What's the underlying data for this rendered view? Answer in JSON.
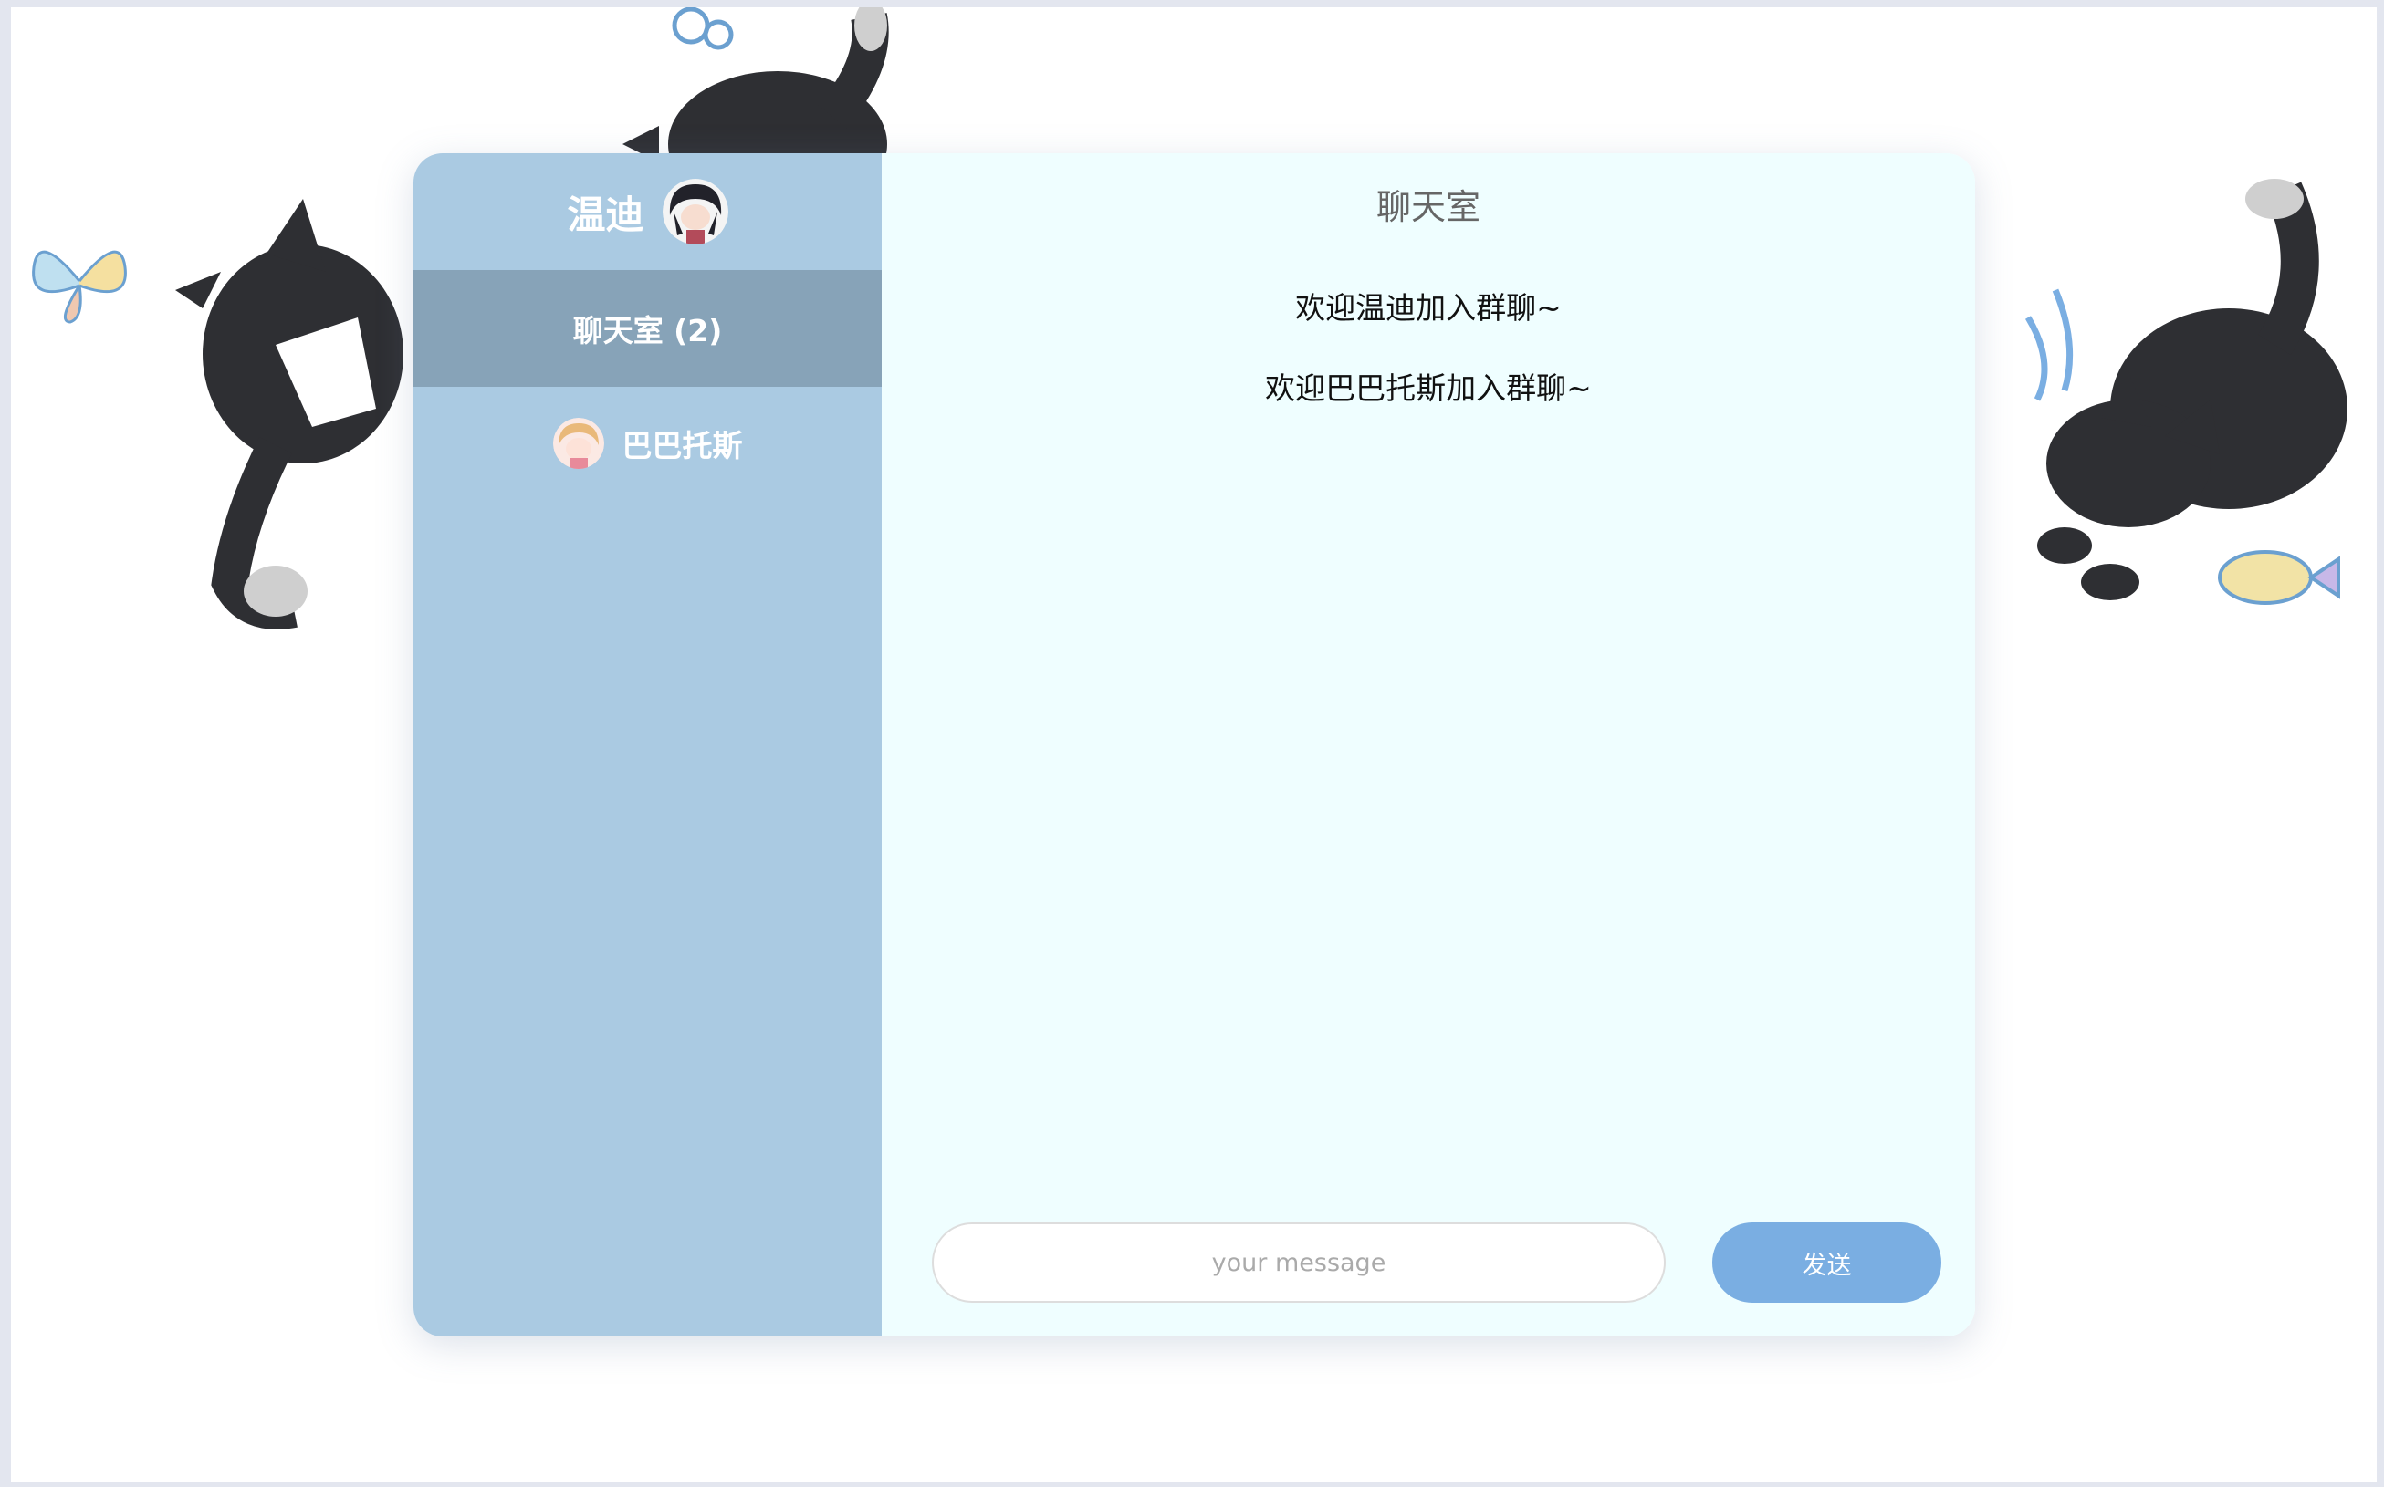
{
  "sidebar": {
    "username": "温迪",
    "room_label": "聊天室 (2)",
    "users": [
      {
        "name": "巴巴托斯"
      }
    ]
  },
  "main": {
    "title": "聊天室",
    "messages": [
      {
        "text": "欢迎温迪加入群聊~"
      },
      {
        "text": "欢迎巴巴托斯加入群聊~"
      }
    ]
  },
  "composer": {
    "placeholder": "your message",
    "send_label": "发送"
  },
  "colors": {
    "sidebar": "#aacae2",
    "sidebar_active": "#87a3b8",
    "chat_bg": "#effeff",
    "send_button": "#7aaee2"
  },
  "background_art": "cats-and-butterflies-illustration"
}
